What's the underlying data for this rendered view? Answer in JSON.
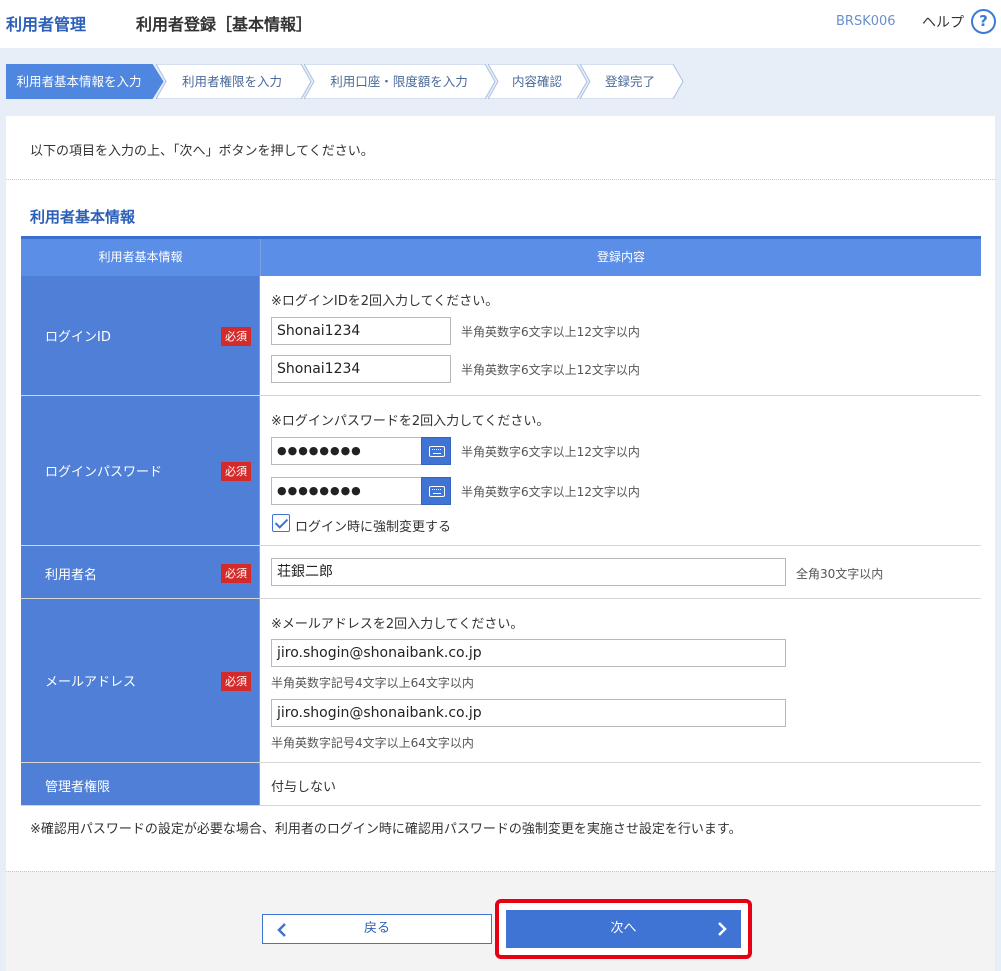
{
  "header": {
    "section": "利用者管理",
    "title": "利用者登録［基本情報］",
    "screen_code": "BRSK006",
    "help_label": "ヘルプ",
    "help_icon": "?"
  },
  "steps": [
    {
      "label": "利用者基本情報を入力",
      "active": true
    },
    {
      "label": "利用者権限を入力",
      "active": false
    },
    {
      "label": "利用口座・限度額を入力",
      "active": false
    },
    {
      "label": "内容確認",
      "active": false
    },
    {
      "label": "登録完了",
      "active": false
    }
  ],
  "intro": "以下の項目を入力の上、「次へ」ボタンを押してください。",
  "section_title": "利用者基本情報",
  "table": {
    "col_label": "利用者基本情報",
    "col_value": "登録内容",
    "required_badge": "必須",
    "login_id": {
      "label": "ログインID",
      "instruction": "※ログインIDを2回入力してください。",
      "value1": "Shonai1234",
      "value2": "Shonai1234",
      "note": "半角英数字6文字以上12文字以内"
    },
    "password": {
      "label": "ログインパスワード",
      "instruction": "※ログインパスワードを2回入力してください。",
      "value1": "●●●●●●●●",
      "value2": "●●●●●●●●",
      "note": "半角英数字6文字以上12文字以内",
      "force_change_label": "ログイン時に強制変更する",
      "force_change_checked": true
    },
    "user_name": {
      "label": "利用者名",
      "value": "荘銀二郎",
      "note": "全角30文字以内"
    },
    "email": {
      "label": "メールアドレス",
      "instruction": "※メールアドレスを2回入力してください。",
      "value1": "jiro.shogin@shonaibank.co.jp",
      "value2": "jiro.shogin@shonaibank.co.jp",
      "note": "半角英数字記号4文字以上64文字以内"
    },
    "admin": {
      "label": "管理者権限",
      "value": "付与しない"
    }
  },
  "footnote": "※確認用パスワードの設定が必要な場合、利用者のログイン時に確認用パスワードの強制変更を実施させ設定を行います。",
  "buttons": {
    "back": "戻る",
    "next": "次へ"
  },
  "colors": {
    "primary": "#3f74d4",
    "label_bg": "#4f7fd6",
    "required": "#d42a2a",
    "highlight": "#e60012"
  }
}
